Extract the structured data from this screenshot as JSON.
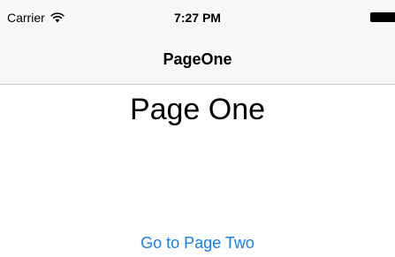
{
  "status_bar": {
    "carrier": "Carrier",
    "time": "7:27 PM",
    "icons": [
      "wifi-icon",
      "battery-icon"
    ]
  },
  "nav_bar": {
    "title": "PageOne"
  },
  "main": {
    "heading": "Page One",
    "link_label": "Go to Page Two"
  },
  "colors": {
    "nav_background": "#f7f7f7",
    "nav_border": "#c8c8c8",
    "link_blue": "#1a7ee6",
    "text": "#000000",
    "background": "#ffffff"
  }
}
